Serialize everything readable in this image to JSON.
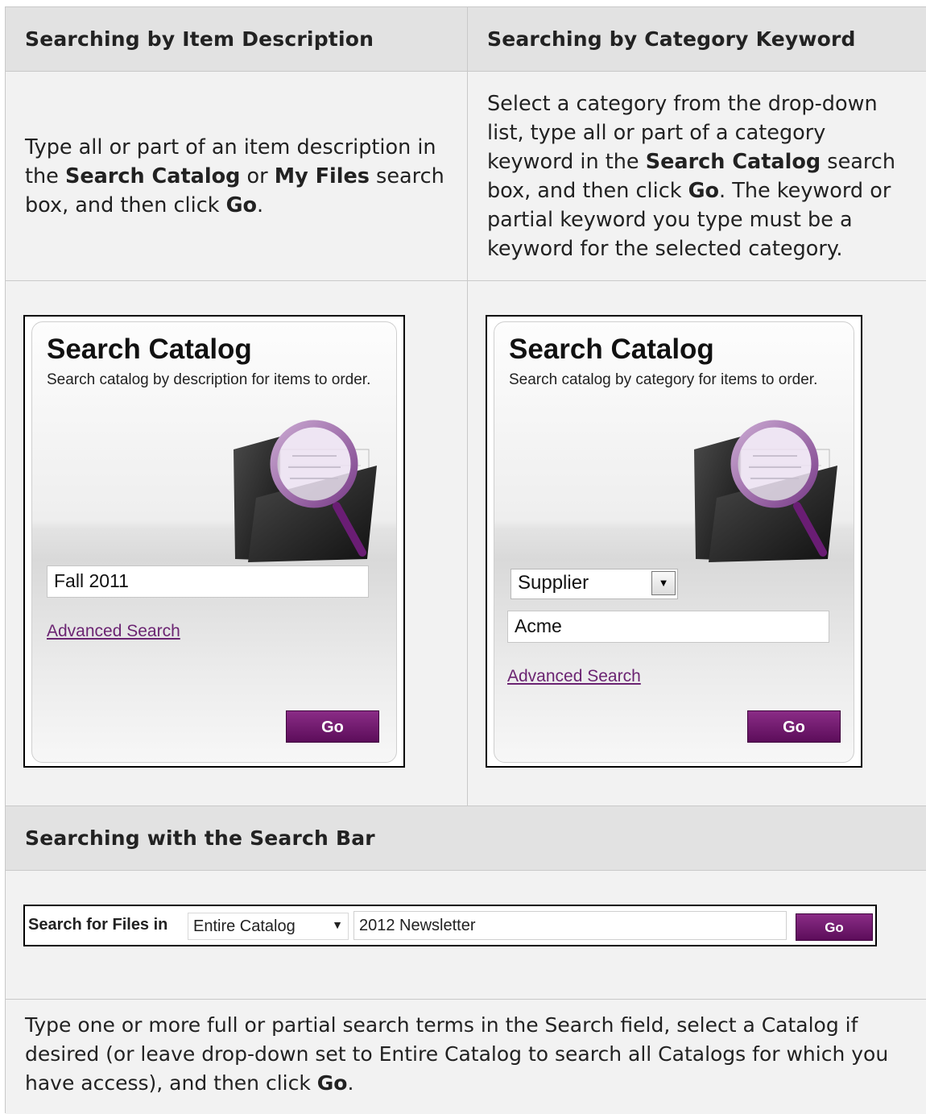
{
  "header_left": "Searching by Item Description",
  "header_right": "Searching by Category Keyword",
  "desc_left": {
    "p1": "Type all or part of an item description in the ",
    "b1": "Search Catalog",
    "p2": " or ",
    "b2": "My Files",
    "p3": " search box, and then click ",
    "b3": "Go",
    "p4": "."
  },
  "desc_right": {
    "p1": "Select a category from the drop-down list, type all or part of a category keyword in the ",
    "b1": "Search Catalog",
    "p2": " search box, and then click ",
    "b2": "Go",
    "p3": ". The keyword or partial keyword you type must be a keyword for the selected category."
  },
  "widget_left": {
    "title": "Search Catalog",
    "description": "Search catalog by description for items to order.",
    "input_value": "Fall 2011",
    "link": "Advanced Search",
    "go": "Go",
    "icon": "folder-magnifier-icon"
  },
  "widget_right": {
    "title": "Search Catalog",
    "description": "Search catalog by category for items to order.",
    "select_value": "Supplier",
    "input_value": "Acme",
    "link": "Advanced Search",
    "go": "Go",
    "icon": "folder-magnifier-icon"
  },
  "header_bottom": "Searching with the Search Bar",
  "search_bar": {
    "label": "Search for Files in",
    "select_value": "Entire Catalog",
    "input_value": "2012 Newsletter",
    "go": "Go"
  },
  "desc_bottom": {
    "p1": "Type one or more full or partial search terms in the Search field, select a Catalog if desired (or leave drop-down set to Entire Catalog to search all Catalogs for which you have access), and then click ",
    "b1": "Go",
    "p2": "."
  },
  "colors": {
    "header_bg": "#e2e2e2",
    "cell_bg": "#f2f2f2",
    "accent_purple": "#6b1468",
    "link_purple": "#6b2472"
  }
}
